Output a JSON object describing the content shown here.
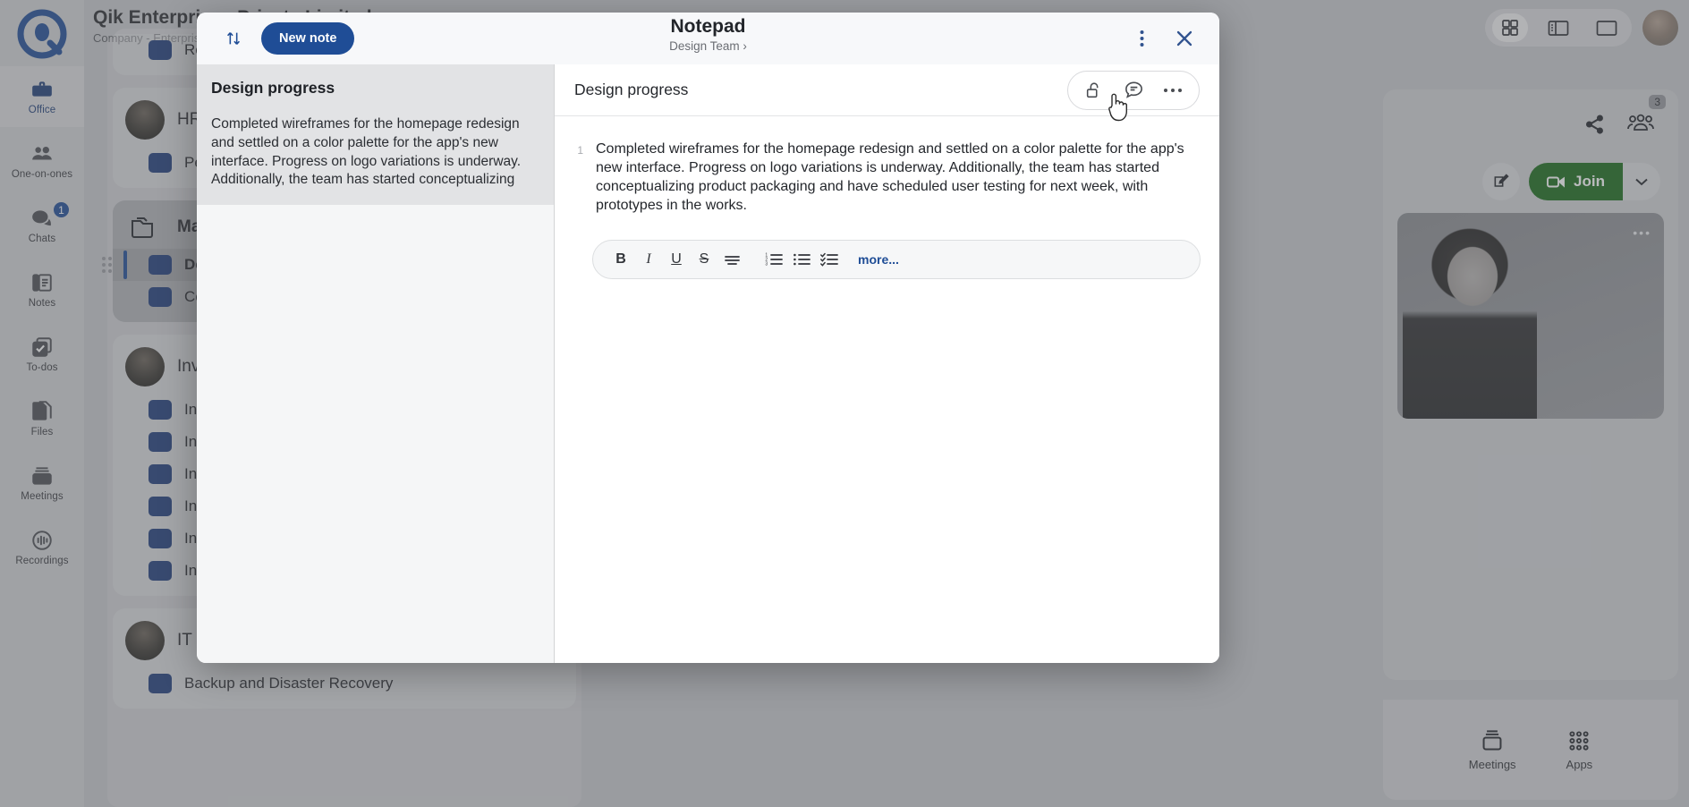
{
  "app": {
    "header": {
      "title": "Qik Enterprises Private Limited",
      "subtitle": "Company - Enterprise"
    },
    "rail": {
      "logo_name": "qik-logo",
      "items": [
        {
          "label": "Office",
          "icon": "briefcase-icon",
          "active": true,
          "badge": ""
        },
        {
          "label": "One-on-ones",
          "icon": "people-icon",
          "active": false,
          "badge": ""
        },
        {
          "label": "Chats",
          "icon": "chat-bubbles-icon",
          "active": false,
          "badge": "1"
        },
        {
          "label": "Notes",
          "icon": "notes-icon",
          "active": false,
          "badge": ""
        },
        {
          "label": "To-dos",
          "icon": "checkbox-stack-icon",
          "active": false,
          "badge": ""
        },
        {
          "label": "Files",
          "icon": "files-icon",
          "active": false,
          "badge": ""
        },
        {
          "label": "Meetings",
          "icon": "meetings-icon",
          "active": false,
          "badge": ""
        },
        {
          "label": "Recordings",
          "icon": "recordings-icon",
          "active": false,
          "badge": ""
        }
      ]
    },
    "topright": {
      "layout_grid": "grid-layout-icon",
      "layout_split": "split-layout-icon",
      "layout_single": "single-layout-icon",
      "avatar": "user-avatar"
    },
    "groups": [
      {
        "name": "",
        "bold": false,
        "has_avatar": false,
        "rows": [
          {
            "label": "Research",
            "selected": false,
            "bold": false
          }
        ]
      },
      {
        "name": "HR",
        "bold": false,
        "has_avatar": true,
        "rows": [
          {
            "label": "Performance",
            "selected": false,
            "bold": false
          }
        ]
      },
      {
        "name": "Marketing",
        "bold": true,
        "has_avatar": false,
        "highlight": true,
        "rows": [
          {
            "label": "Design",
            "selected": true,
            "bold": true
          },
          {
            "label": "Content",
            "selected": false,
            "bold": false
          }
        ]
      },
      {
        "name": "Investors",
        "bold": false,
        "has_avatar": true,
        "rows": [
          {
            "label": "Investor A",
            "selected": false,
            "bold": false
          },
          {
            "label": "Investor B",
            "selected": false,
            "bold": false
          },
          {
            "label": "Investor C",
            "selected": false,
            "bold": false
          },
          {
            "label": "Investor D",
            "selected": false,
            "bold": false
          },
          {
            "label": "Investor E",
            "selected": false,
            "bold": false
          },
          {
            "label": "Investor F",
            "selected": false,
            "bold": false
          }
        ]
      },
      {
        "name": "IT & Admin",
        "bold": false,
        "has_avatar": true,
        "rows": [
          {
            "label": "Backup and Disaster Recovery",
            "selected": false,
            "bold": false
          }
        ]
      }
    ],
    "meeting_panel": {
      "share_icon": "share-icon",
      "people_icon": "people-group-icon",
      "people_count": "3",
      "compose_icon": "compose-icon",
      "join_label": "Join",
      "join_caret": "chevron-down-icon",
      "join_color": "#1a6b1a",
      "tile_more": "•••"
    },
    "dock": {
      "items": [
        {
          "label": "Meetings",
          "icon": "meetings-icon"
        },
        {
          "label": "Apps",
          "icon": "apps-grid-icon"
        }
      ]
    }
  },
  "modal": {
    "header": {
      "sort_icon": "sort-arrows-icon",
      "new_note_label": "New note",
      "title": "Notepad",
      "breadcrumb": "Design Team",
      "breadcrumb_chevron": "›",
      "more_icon": "kebab-menu-icon",
      "close_icon": "close-icon",
      "accent": "#1f4d96"
    },
    "note_list": [
      {
        "title": "Design progress",
        "preview": "Completed wireframes for the homepage redesign and settled on a color palette for the app's new interface. Progress on logo variations is underway. Additionally, the team has started conceptualizing product packaging and have scheduled user testing for next week, with"
      }
    ],
    "editor": {
      "title": "Design progress",
      "lock_icon": "unlock-icon",
      "comment_icon": "comment-icon",
      "more_icon": "ellipsis-icon",
      "line_number": "1",
      "body": "Completed wireframes for the homepage redesign and settled on a color palette for the app's new interface. Progress on logo variations is underway. Additionally, the team has started conceptualizing product packaging and have scheduled user testing for next week, with prototypes in the works.",
      "toolbar": {
        "bold": "B",
        "italic": "I",
        "underline": "U",
        "strikethrough": "S",
        "align": "align-icon",
        "numbered_list": "numbered-list-icon",
        "bullet_list": "bullet-list-icon",
        "checklist": "checklist-icon",
        "more_label": "more...",
        "more_color": "#1f4d96"
      }
    }
  }
}
